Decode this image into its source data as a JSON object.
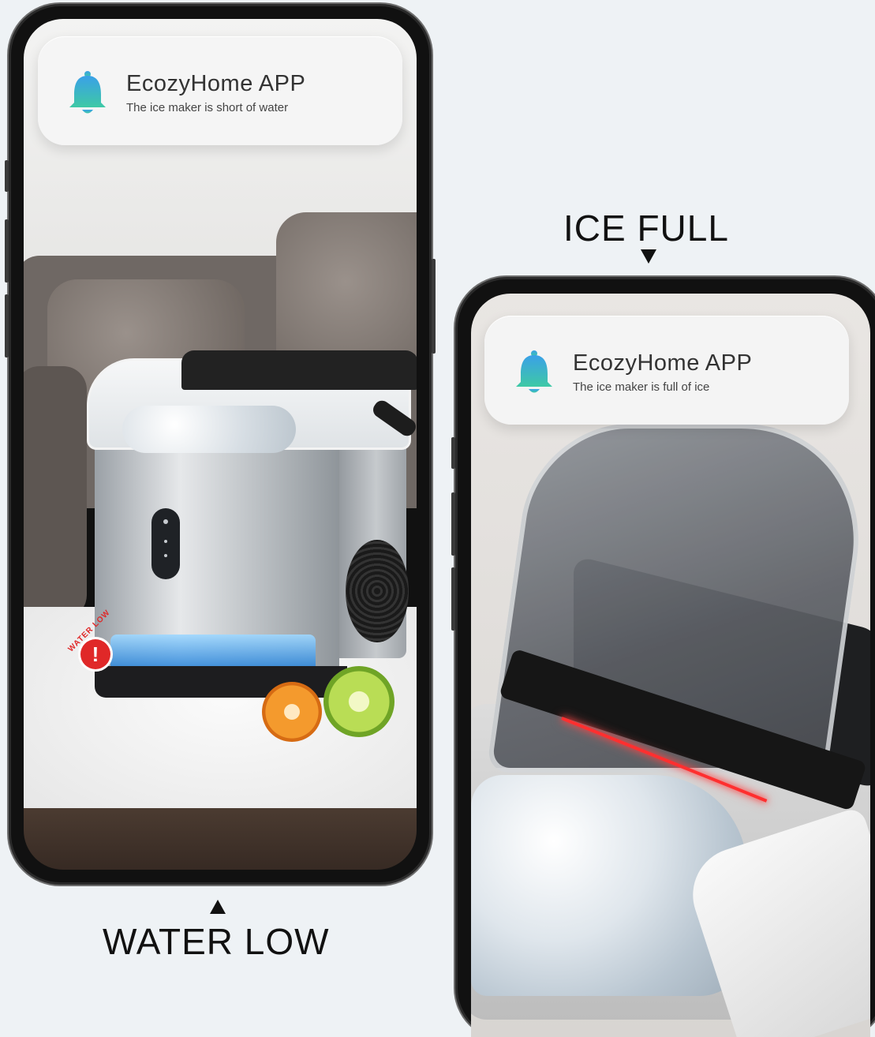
{
  "notifications": [
    {
      "app": "EcozyHome APP",
      "message": "The ice maker is short of water"
    },
    {
      "app": "EcozyHome APP",
      "message": "The ice maker is full of ice"
    }
  ],
  "captions": {
    "left": "WATER LOW",
    "right": "ICE FULL"
  },
  "badges": {
    "water_low_label": "WATER LOW",
    "alert_glyph": "!"
  },
  "icons": {
    "notification": "bell-icon"
  },
  "colors": {
    "bell_top": "#3aa0e8",
    "bell_bottom": "#3ec9a5",
    "alert": "#e02828",
    "laser": "#ff2f2f"
  }
}
